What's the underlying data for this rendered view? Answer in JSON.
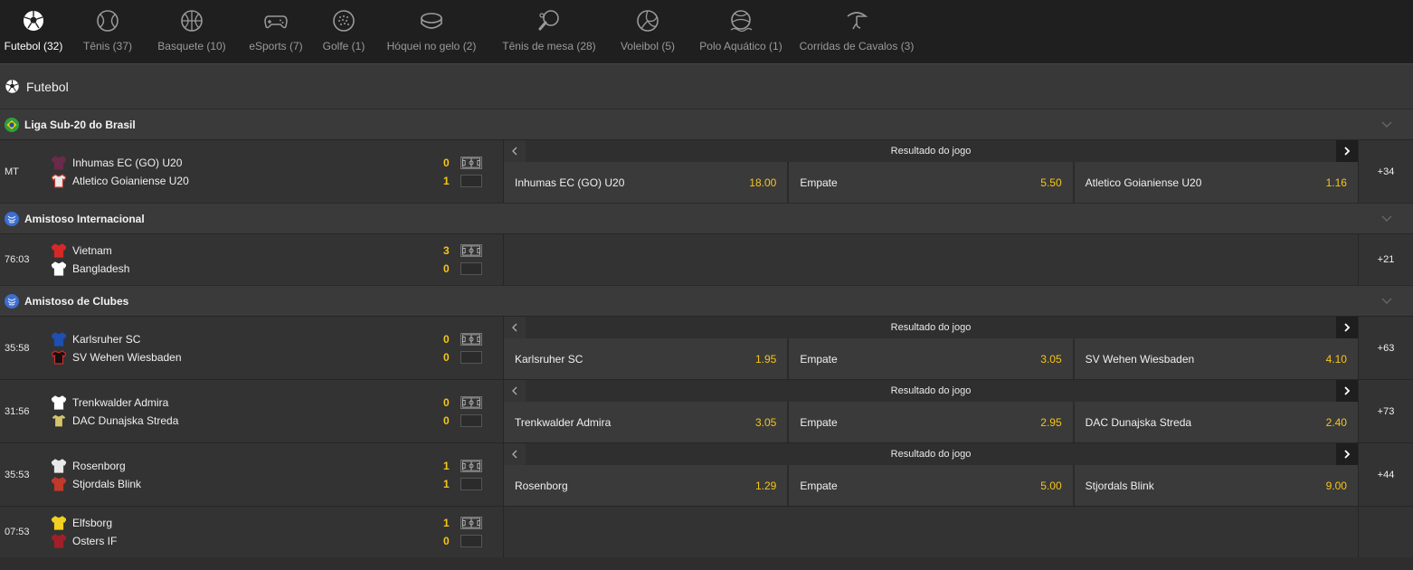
{
  "sports": [
    {
      "label": "Futebol (32)",
      "icon": "soccer-ball-icon",
      "active": true
    },
    {
      "label": "Tênis (37)",
      "icon": "tennis-ball-icon"
    },
    {
      "label": "Basquete (10)",
      "icon": "basketball-icon"
    },
    {
      "label": "eSports (7)",
      "icon": "gamepad-icon"
    },
    {
      "label": "Golfe (1)",
      "icon": "golf-ball-icon"
    },
    {
      "label": "Hóquei no gelo (2)",
      "icon": "hockey-puck-icon"
    },
    {
      "label": "Tênis de mesa (28)",
      "icon": "ping-pong-icon"
    },
    {
      "label": "Voleibol (5)",
      "icon": "volleyball-icon"
    },
    {
      "label": "Polo Aquático (1)",
      "icon": "water-polo-icon"
    },
    {
      "label": "Corridas de Cavalos (3)",
      "icon": "horse-racing-icon"
    }
  ],
  "section_title": "Futebol",
  "market_title": "Resultado do jogo",
  "leagues": [
    {
      "name": "Liga Sub-20 do Brasil",
      "flag": "brazil-flag-icon",
      "matches": [
        {
          "time": "MT",
          "home": "Inhumas EC (GO) U20",
          "away": "Atletico Goianiense U20",
          "home_score": "0",
          "away_score": "1",
          "odds": [
            {
              "name": "Inhumas EC (GO) U20",
              "value": "18.00"
            },
            {
              "name": "Empate",
              "value": "5.50"
            },
            {
              "name": "Atletico Goianiense U20",
              "value": "1.16"
            }
          ],
          "more": "+34"
        }
      ]
    },
    {
      "name": "Amistoso Internacional",
      "flag": "world-icon",
      "matches": [
        {
          "time": "76:03",
          "home": "Vietnam",
          "away": "Bangladesh",
          "home_score": "3",
          "away_score": "0",
          "odds": [],
          "more": "+21"
        }
      ]
    },
    {
      "name": "Amistoso de Clubes",
      "flag": "world-icon",
      "matches": [
        {
          "time": "35:58",
          "home": "Karlsruher SC",
          "away": "SV Wehen Wiesbaden",
          "home_score": "0",
          "away_score": "0",
          "odds": [
            {
              "name": "Karlsruher SC",
              "value": "1.95"
            },
            {
              "name": "Empate",
              "value": "3.05"
            },
            {
              "name": "SV Wehen Wiesbaden",
              "value": "4.10"
            }
          ],
          "more": "+63"
        },
        {
          "time": "31:56",
          "home": "Trenkwalder Admira",
          "away": "DAC Dunajska Streda",
          "home_score": "0",
          "away_score": "0",
          "odds": [
            {
              "name": "Trenkwalder Admira",
              "value": "3.05"
            },
            {
              "name": "Empate",
              "value": "2.95"
            },
            {
              "name": "DAC Dunajska Streda",
              "value": "2.40"
            }
          ],
          "more": "+73"
        },
        {
          "time": "35:53",
          "home": "Rosenborg",
          "away": "Stjordals Blink",
          "home_score": "1",
          "away_score": "1",
          "odds": [
            {
              "name": "Rosenborg",
              "value": "1.29"
            },
            {
              "name": "Empate",
              "value": "5.00"
            },
            {
              "name": "Stjordals Blink",
              "value": "9.00"
            }
          ],
          "more": "+44"
        },
        {
          "time": "07:53",
          "home": "Elfsborg",
          "away": "Osters IF",
          "home_score": "1",
          "away_score": "0",
          "odds": [],
          "more": ""
        }
      ]
    }
  ],
  "colors": {
    "accent": "#f5c518",
    "bg": "#2e2e2e",
    "tabbar": "#1f1f1f"
  }
}
